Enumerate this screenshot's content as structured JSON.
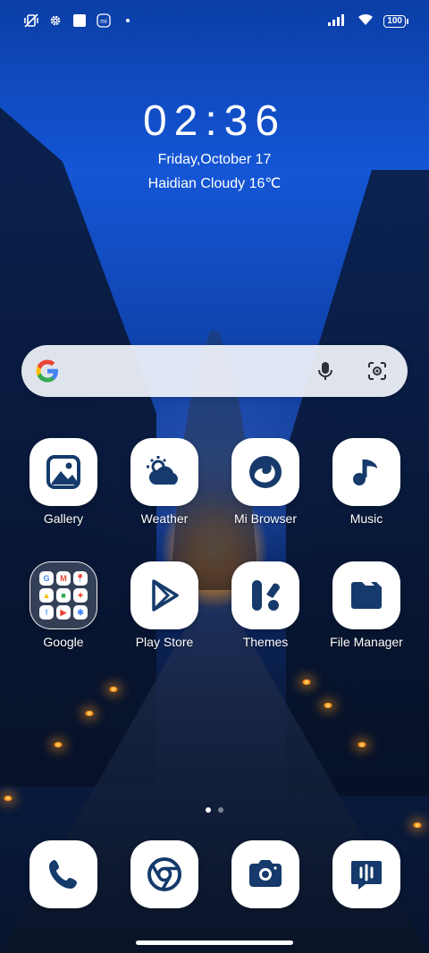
{
  "status_bar": {
    "battery": "100",
    "icons_left": [
      "vibrate-off-icon",
      "settings-gear-icon",
      "square-notification-icon",
      "mi-icon",
      "dot-icon"
    ],
    "icons_right": [
      "signal-icon",
      "wifi-icon",
      "battery-icon"
    ]
  },
  "lock_widget": {
    "time": "02:36",
    "date": "Friday,October 17",
    "weather": "Haidian Cloudy 16℃"
  },
  "search_bar": {
    "brand_icon": "google-g-icon",
    "mic_icon": "mic-icon",
    "lens_icon": "lens-icon"
  },
  "apps": [
    {
      "label": "Gallery",
      "icon": "gallery-icon"
    },
    {
      "label": "Weather",
      "icon": "weather-icon"
    },
    {
      "label": "Mi Browser",
      "icon": "browser-icon"
    },
    {
      "label": "Music",
      "icon": "music-icon"
    },
    {
      "label": "Google",
      "icon": "folder-icon"
    },
    {
      "label": "Play Store",
      "icon": "play-store-icon"
    },
    {
      "label": "Themes",
      "icon": "themes-icon"
    },
    {
      "label": "File Manager",
      "icon": "file-manager-icon"
    }
  ],
  "google_folder_minis": [
    "G",
    "M",
    "📍",
    "▲",
    "■",
    "✦",
    "!",
    "▶",
    "✱"
  ],
  "page_indicator": {
    "pages": 2,
    "current": 1
  },
  "dock": [
    {
      "icon": "phone-icon"
    },
    {
      "icon": "chrome-icon"
    },
    {
      "icon": "camera-icon"
    },
    {
      "icon": "messages-icon"
    }
  ],
  "colors": {
    "icon_navy": "#153a6b",
    "sky": "#1456d6"
  }
}
